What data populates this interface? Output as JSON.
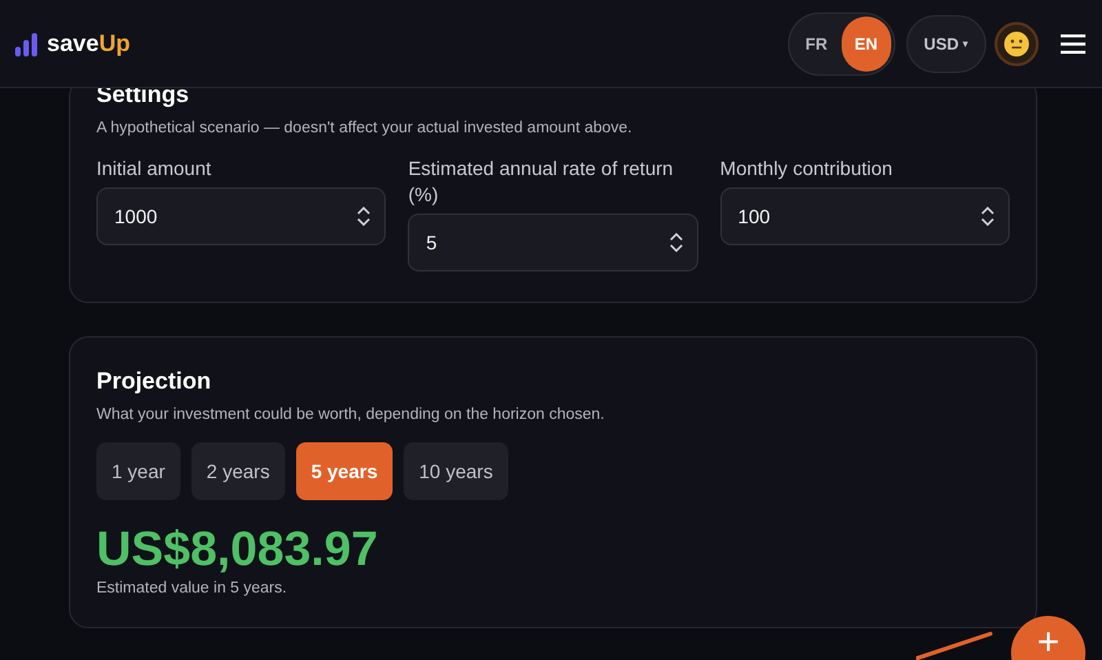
{
  "header": {
    "brand": {
      "prefix": "save",
      "accent": "Up"
    },
    "languages": [
      {
        "label": "FR",
        "selected": false
      },
      {
        "label": "EN",
        "selected": true
      }
    ],
    "currency": "USD",
    "currency_caret": "▾"
  },
  "settings": {
    "title": "Settings",
    "subtitle": "A hypothetical scenario — doesn't affect your actual invested amount above.",
    "fields": [
      {
        "label": "Initial amount",
        "value": "1000"
      },
      {
        "label": "Estimated annual rate of return (%)",
        "value": "5"
      },
      {
        "label": "Monthly contribution",
        "value": "100"
      }
    ]
  },
  "projection": {
    "title": "Projection",
    "subtitle": "What your investment could be worth, depending on the horizon chosen.",
    "horizons": [
      {
        "label": "1 year",
        "selected": false
      },
      {
        "label": "2 years",
        "selected": false
      },
      {
        "label": "5 years",
        "selected": true
      },
      {
        "label": "10 years",
        "selected": false
      }
    ],
    "amount": "US$8,083.97",
    "caption": "Estimated value in 5 years."
  },
  "fab": {
    "label": "+"
  }
}
